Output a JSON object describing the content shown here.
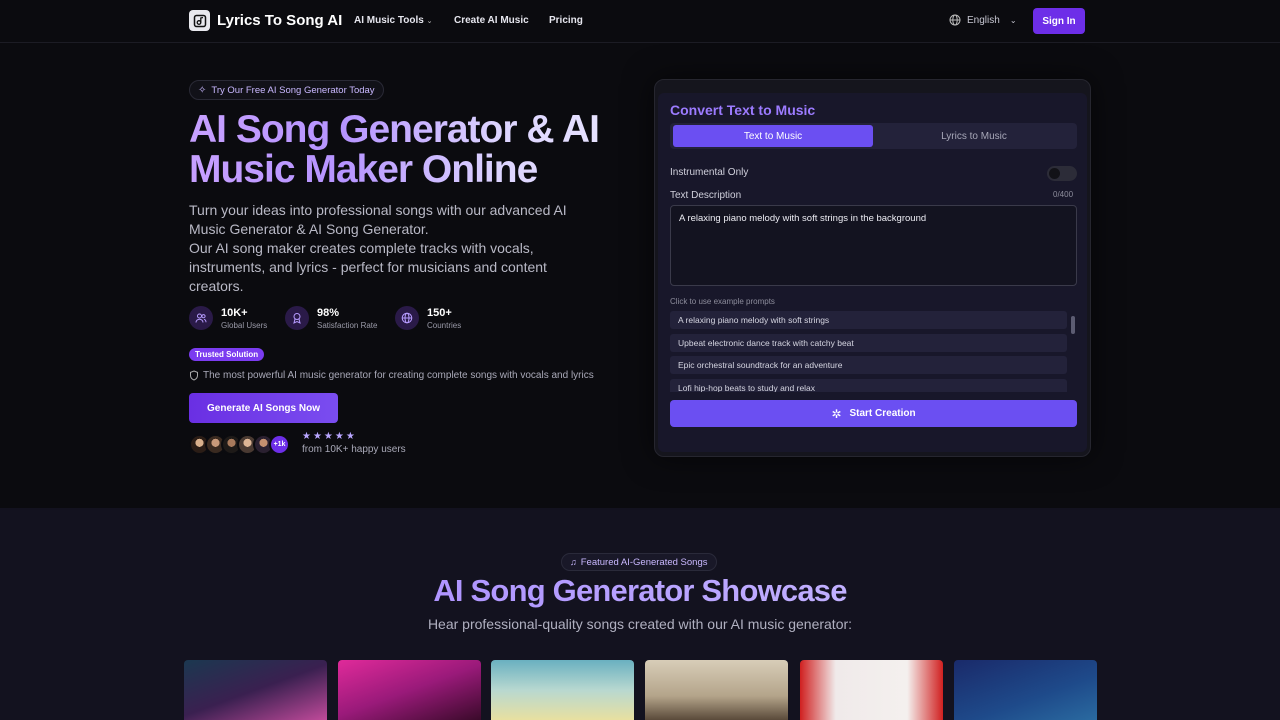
{
  "nav": {
    "logo": "Lyrics To Song AI",
    "links": [
      "AI Music Tools",
      "Create AI Music",
      "Pricing"
    ],
    "language": "English",
    "signin": "Sign In"
  },
  "hero": {
    "pill": "Try Our Free AI Song Generator Today",
    "title": "AI Song Generator & AI Music Maker Online",
    "description": "Turn your ideas into professional songs with our advanced AI Music Generator & AI Song Generator.",
    "description2": "Our AI song maker creates complete tracks with vocals, instruments, and lyrics - perfect for musicians and content creators.",
    "stats": [
      {
        "value": "10K+",
        "label": "Global Users"
      },
      {
        "value": "98%",
        "label": "Satisfaction Rate"
      },
      {
        "value": "150+",
        "label": "Countries"
      }
    ],
    "trusted_badge": "Trusted Solution",
    "trusted_text": "The most powerful AI music generator for creating complete songs with vocals and lyrics",
    "cta": "Generate AI Songs Now",
    "avatars_more": "+1k",
    "stars": "★★★★★",
    "happy_users": "from 10K+ happy users"
  },
  "converter": {
    "title": "Convert Text to Music",
    "tabs": [
      "Text to Music",
      "Lyrics to Music"
    ],
    "instrumental_label": "Instrumental Only",
    "instrumental_on": false,
    "text_label": "Text Description",
    "char_count": "0/400",
    "text_value": "A relaxing piano melody with soft strings in the background",
    "examples_label": "Click to use example prompts",
    "examples": [
      "A relaxing piano melody with soft strings",
      "Upbeat electronic dance track with catchy beat",
      "Epic orchestral soundtrack for an adventure",
      "Lofi hip-hop beats to study and relax"
    ],
    "start_button": "Start Creation"
  },
  "showcase": {
    "pill": "Featured AI-Generated Songs",
    "title": "AI Song Generator Showcase",
    "subtitle": "Hear professional-quality songs created with our AI music generator:"
  },
  "colors": {
    "accent": "#6d2ee8",
    "button": "#6b4ff2",
    "background": "#0b0b0f"
  }
}
